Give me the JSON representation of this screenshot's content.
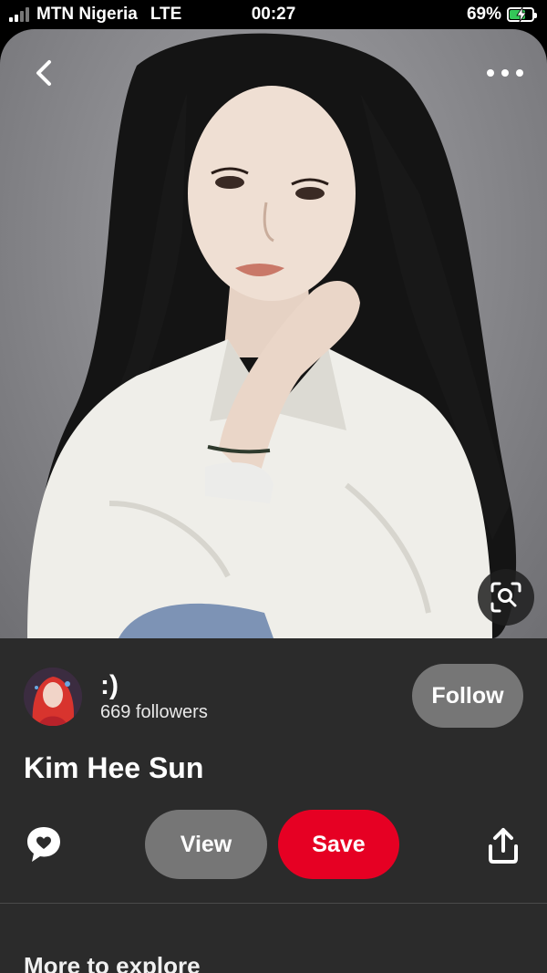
{
  "status_bar": {
    "carrier": "MTN Nigeria",
    "network": "LTE",
    "time": "00:27",
    "battery_percent": "69%",
    "battery_level": 0.69,
    "icons": [
      "cellular-signal-icon",
      "battery-charging-icon"
    ]
  },
  "photo": {
    "icons": [
      "back-chevron-icon",
      "more-dots-icon",
      "visual-search-icon"
    ]
  },
  "creator": {
    "name": ":)",
    "followers": "669 followers",
    "follow_label": "Follow"
  },
  "pin": {
    "title": "Kim Hee Sun"
  },
  "actions": {
    "view_label": "View",
    "save_label": "Save",
    "icons": [
      "comment-heart-icon",
      "share-upload-icon"
    ]
  },
  "more_section": {
    "title": "More to explore"
  },
  "colors": {
    "save_red": "#e60023",
    "panel_bg": "#2b2b2b",
    "pill_gray": "#767676",
    "battery_green": "#34c759"
  }
}
